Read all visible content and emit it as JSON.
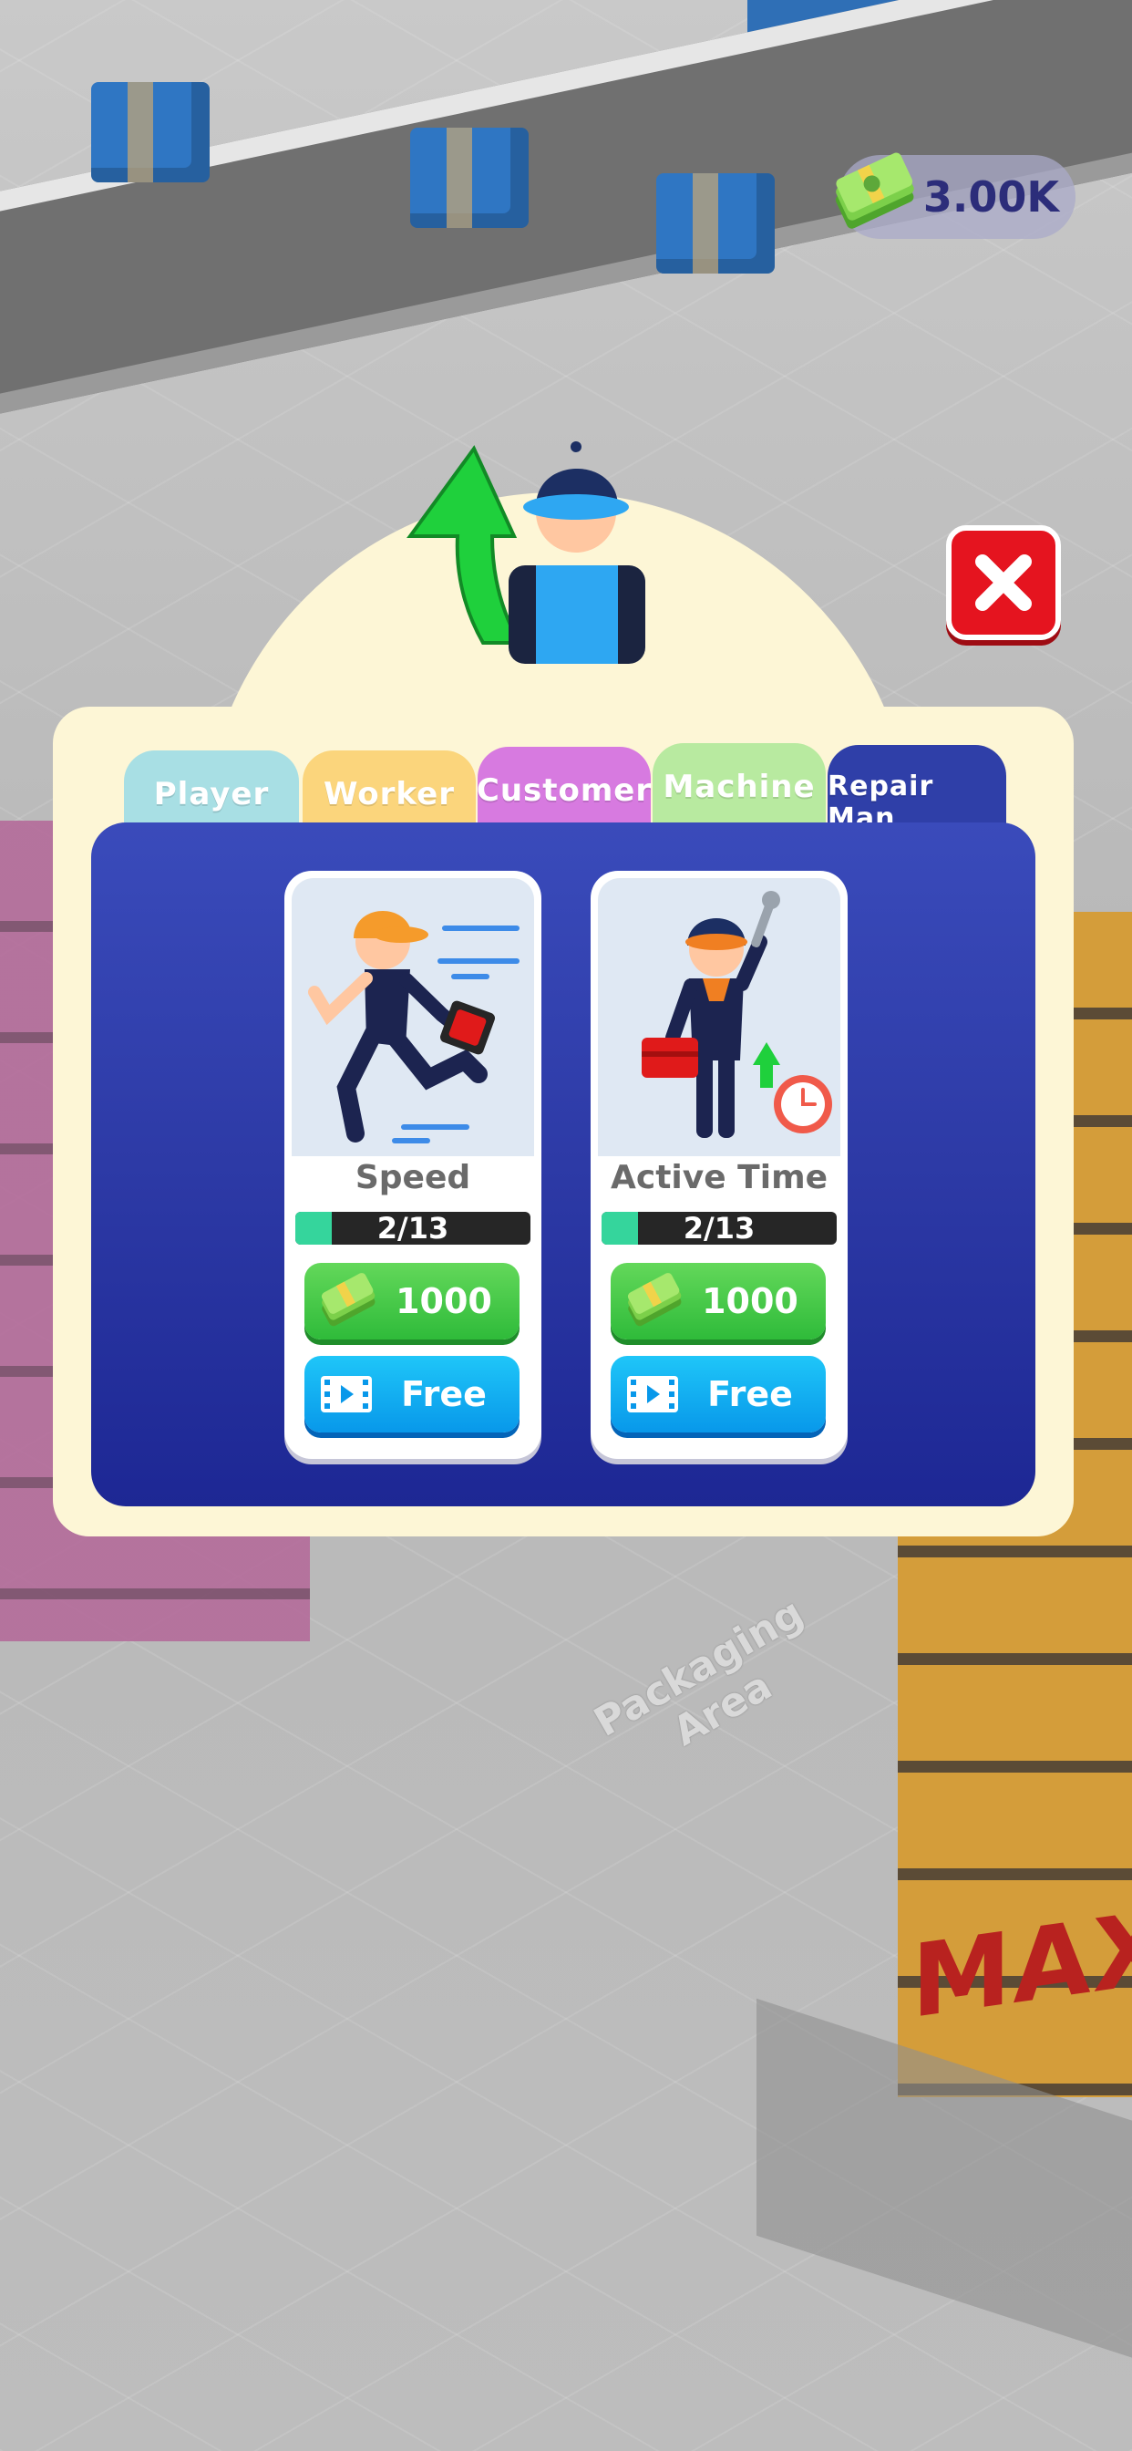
{
  "hud": {
    "currency": "3.00K",
    "currency_icon": "cash-stack-icon"
  },
  "scene": {
    "floor_label": "Packaging Area",
    "max_label": "MAX"
  },
  "modal": {
    "close_icon": "close-icon",
    "header_icon": "worker-upgrade-icon",
    "tabs": [
      {
        "label": "Player",
        "color": "#a8dfe4"
      },
      {
        "label": "Worker",
        "color": "#fbd57c"
      },
      {
        "label": "Customer",
        "color": "#d77ae0"
      },
      {
        "label": "Machine",
        "color": "#b8eaa0"
      },
      {
        "label": "Repair Man",
        "color": "#2f3fa8",
        "selected": true
      }
    ],
    "cards": [
      {
        "title": "Speed",
        "art_icon": "running-repairman-icon",
        "level": 2,
        "max_level": 13,
        "level_text": "2/13",
        "price": "1000",
        "price_icon": "cash-icon",
        "free_label": "Free",
        "free_icon": "video-ad-icon"
      },
      {
        "title": "Active Time",
        "art_icon": "repairman-clock-icon",
        "level": 2,
        "max_level": 13,
        "level_text": "2/13",
        "price": "1000",
        "price_icon": "cash-icon",
        "free_label": "Free",
        "free_icon": "video-ad-icon"
      }
    ]
  }
}
